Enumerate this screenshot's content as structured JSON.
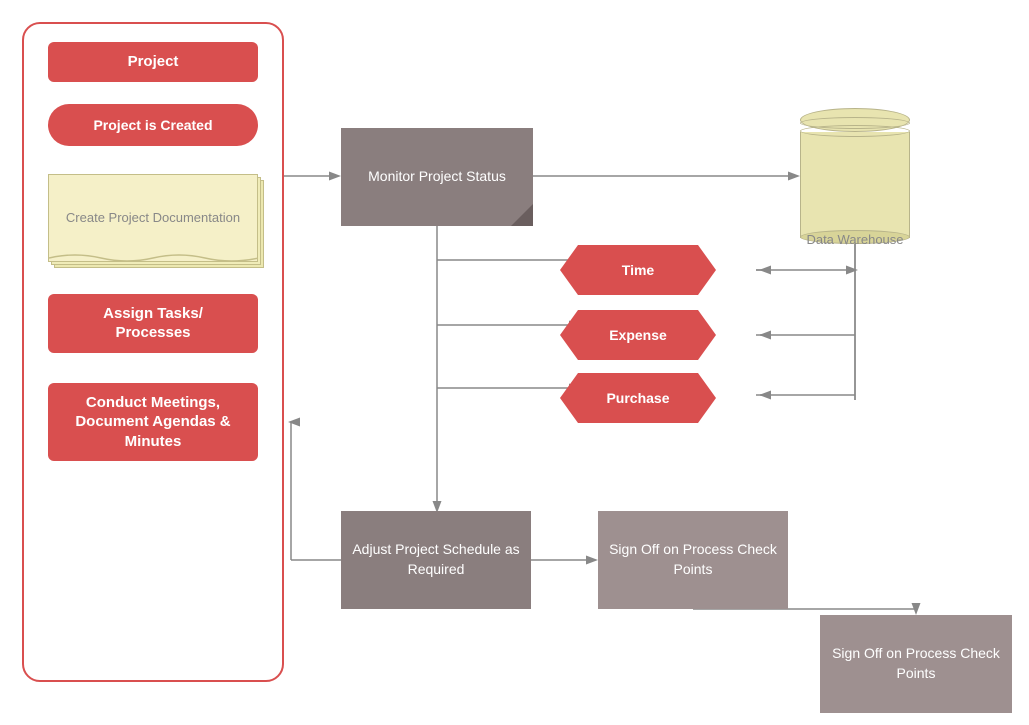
{
  "leftPanel": {
    "title": "Project",
    "items": [
      {
        "id": "project-created",
        "label": "Project is Created",
        "type": "pill"
      },
      {
        "id": "create-docs",
        "label": "Create Project Documentation",
        "type": "doc"
      },
      {
        "id": "assign-tasks",
        "label": "Assign Tasks/ Processes",
        "type": "rect"
      },
      {
        "id": "conduct-meetings",
        "label": "Conduct Meetings, Document Agendas & Minutes",
        "type": "rect"
      }
    ]
  },
  "mainFlow": {
    "monitorBox": {
      "label": "Monitor Project\nStatus"
    },
    "dataWarehouse": {
      "label": "Data Warehouse"
    },
    "hexagons": [
      {
        "id": "time",
        "label": "Time"
      },
      {
        "id": "expense",
        "label": "Expense"
      },
      {
        "id": "purchase",
        "label": "Purchase"
      }
    ],
    "adjustBox": {
      "label": "Adjust Project Schedule as Required"
    },
    "signOff1": {
      "label": "Sign Off on Process Check Points"
    },
    "signOff2": {
      "label": "Sign Off on Process Check Points"
    }
  }
}
